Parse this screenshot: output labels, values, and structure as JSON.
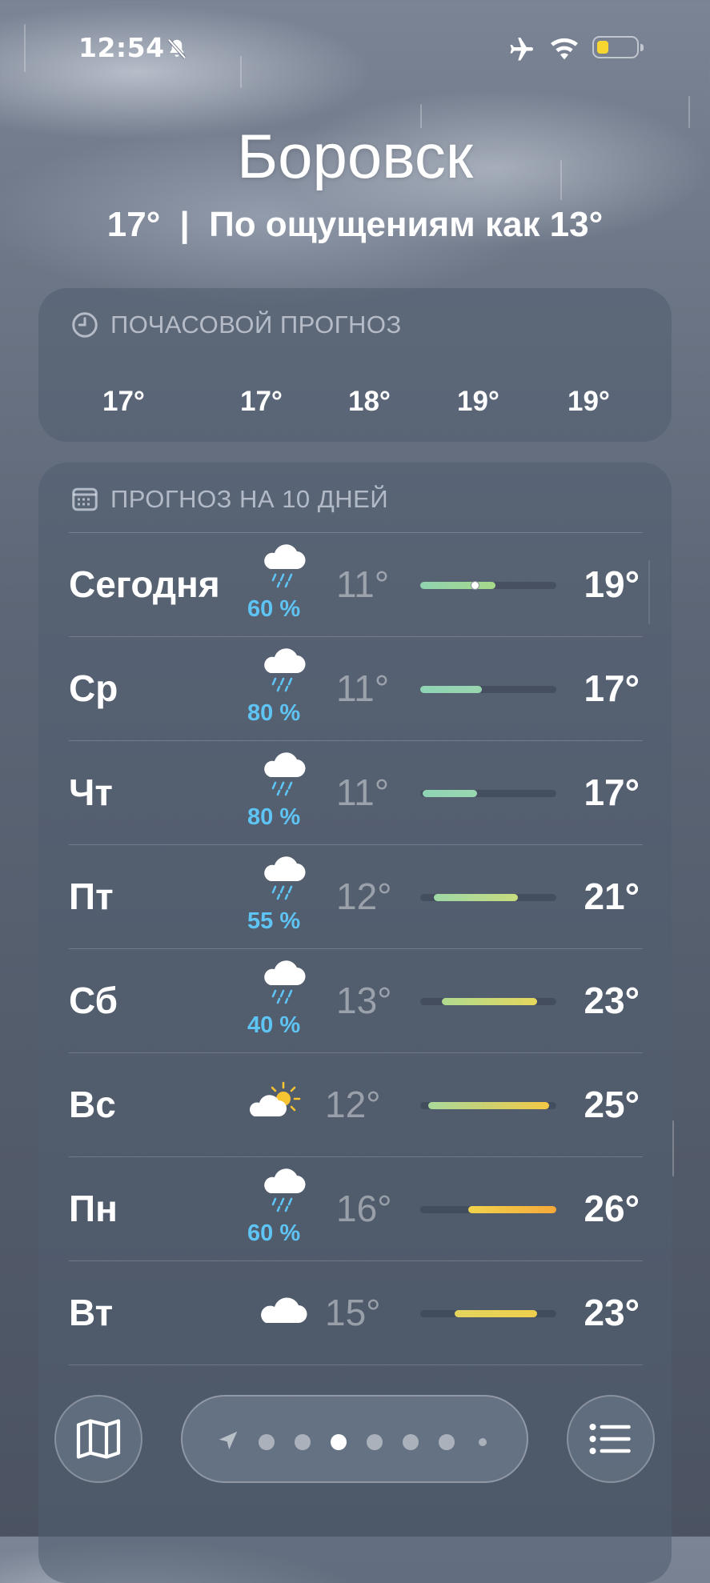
{
  "status_bar": {
    "time": "12:54",
    "battery_color": "#f7d632"
  },
  "location": {
    "city": "Боровск",
    "current_temp": "17°",
    "separator": "|",
    "feels_like": "По ощущениям как 13°"
  },
  "hourly": {
    "title": "ПОЧАСОВОЙ ПРОГНОЗ",
    "temps": [
      "17°",
      "17°",
      "18°",
      "19°",
      "19°"
    ]
  },
  "daily": {
    "title": "ПРОГНОЗ НА 10 ДНЕЙ",
    "days": [
      {
        "day": "Сегодня",
        "icon": "cloud-rain-icon",
        "precip": "60 %",
        "low": "11°",
        "high": "19°",
        "range": [
          0.0,
          0.55
        ],
        "current": 0.4,
        "colors": [
          "#8fd3b0",
          "#a7d98a"
        ]
      },
      {
        "day": "Ср",
        "icon": "cloud-rain-icon",
        "precip": "80 %",
        "low": "11°",
        "high": "17°",
        "range": [
          0.0,
          0.45
        ],
        "colors": [
          "#8fd3b5",
          "#99d6b0"
        ]
      },
      {
        "day": "Чт",
        "icon": "cloud-rain-icon",
        "precip": "80 %",
        "low": "11°",
        "high": "17°",
        "range": [
          0.02,
          0.42
        ],
        "colors": [
          "#8fd3b5",
          "#99d6b0"
        ]
      },
      {
        "day": "Пт",
        "icon": "cloud-rain-icon",
        "precip": "55 %",
        "low": "12°",
        "high": "21°",
        "range": [
          0.1,
          0.72
        ],
        "colors": [
          "#9fd8a6",
          "#c8dc7e"
        ]
      },
      {
        "day": "Сб",
        "icon": "cloud-rain-icon",
        "precip": "40 %",
        "low": "13°",
        "high": "23°",
        "range": [
          0.16,
          0.86
        ],
        "colors": [
          "#b0da90",
          "#e6d85c"
        ]
      },
      {
        "day": "Вс",
        "icon": "partly-sunny-icon",
        "precip": "",
        "low": "12°",
        "high": "25°",
        "range": [
          0.06,
          0.95
        ],
        "colors": [
          "#a9d99a",
          "#f2c845"
        ]
      },
      {
        "day": "Пн",
        "icon": "cloud-rain-icon",
        "precip": "60 %",
        "low": "16°",
        "high": "26°",
        "range": [
          0.35,
          1.0
        ],
        "colors": [
          "#f1d44d",
          "#f5a83a"
        ]
      },
      {
        "day": "Вт",
        "icon": "cloud-icon",
        "precip": "",
        "low": "15°",
        "high": "23°",
        "range": [
          0.25,
          0.86
        ],
        "colors": [
          "#e3d45e",
          "#efcf4c"
        ]
      }
    ]
  },
  "bottom": {
    "page_count": 7,
    "active_page": 3
  }
}
